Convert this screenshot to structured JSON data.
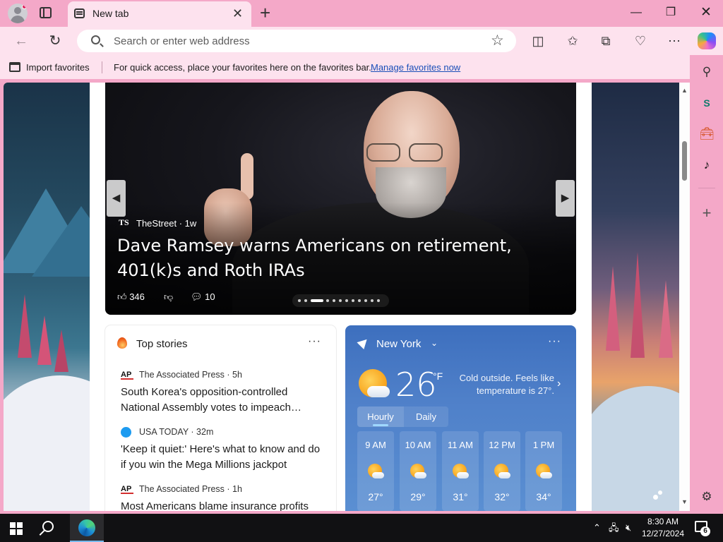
{
  "browser": {
    "tab": {
      "title": "New tab"
    },
    "address_bar": {
      "placeholder": "Search or enter web address",
      "value": ""
    },
    "favorites_bar": {
      "import_label": "Import favorites",
      "message": "For quick access, place your favorites here on the favorites bar.",
      "link": "Manage favorites now"
    },
    "icons": {
      "window": [
        "minimize-icon",
        "restore-icon",
        "close-icon"
      ],
      "toolbar": [
        "back-icon",
        "refresh-icon",
        "favorite-star-icon",
        "split-screen-icon",
        "favorites-icon",
        "collections-icon",
        "browser-essentials-icon",
        "more-icon",
        "copilot-icon"
      ],
      "sidebar": [
        "search-icon",
        "sharepoint-icon",
        "tools-icon",
        "tiktok-icon",
        "add-icon",
        "settings-icon"
      ]
    }
  },
  "hero": {
    "source_logo": "TS",
    "source": "TheStreet · 1w",
    "headline": "Dave Ramsey warns Americans on retirement, 401(k)s and Roth IRAs",
    "likes": "346",
    "comments": "10",
    "slide_count": 12,
    "active_slide": 2
  },
  "top_stories": {
    "title": "Top stories",
    "items": [
      {
        "logo": "AP",
        "source": "The Associated Press · 5h",
        "headline": "South Korea's opposition-controlled National Assembly votes to impeach…"
      },
      {
        "logo": "",
        "source": "USA TODAY · 32m",
        "headline": "'Keep it quiet:' Here's what to know and do if you win the Mega Millions jackpot"
      },
      {
        "logo": "AP",
        "source": "The Associated Press · 1h",
        "headline": "Most Americans blame insurance profits"
      }
    ]
  },
  "weather": {
    "location": "New York",
    "temperature": "26",
    "unit": "°F",
    "condition": "Cold outside. Feels like temperature is 27°.",
    "tabs": [
      "Hourly",
      "Daily"
    ],
    "hourly": [
      {
        "time": "9 AM",
        "temp": "27°"
      },
      {
        "time": "10 AM",
        "temp": "29°"
      },
      {
        "time": "11 AM",
        "temp": "31°"
      },
      {
        "time": "12 PM",
        "temp": "32°"
      },
      {
        "time": "1 PM",
        "temp": "34°"
      }
    ]
  },
  "taskbar": {
    "time": "8:30 AM",
    "date": "12/27/2024",
    "notification_count": "6"
  },
  "colors": {
    "chrome_pink": "#f4a8c8",
    "tab_active": "#fde2ee",
    "weather_blue": "#4f80c9",
    "link_blue": "#1a4fb8",
    "taskbar": "#111113"
  }
}
